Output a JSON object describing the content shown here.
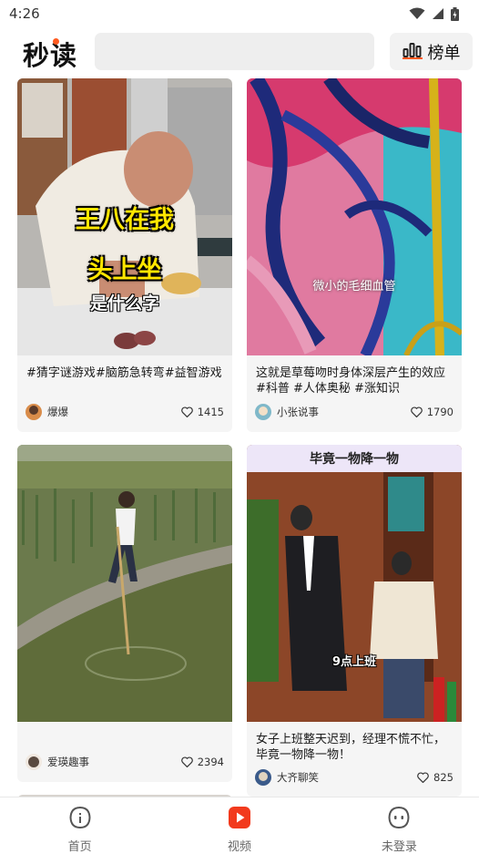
{
  "status_bar": {
    "time": "4:26"
  },
  "header": {
    "logo": "秒读",
    "rank_label": "榜单"
  },
  "feed": [
    {
      "title": "#猜字谜游戏#脑筋急转弯#益智游戏",
      "author": "爆爆",
      "likes": "1415",
      "overlay_line1": "王八在我",
      "overlay_line2": "头上坐",
      "overlay_line3": "是什么字"
    },
    {
      "title": "这就是草莓吻时身体深层产生的效应#科普 #人体奥秘 #涨知识",
      "author": "小张说事",
      "likes": "1790",
      "overlay_caption": "微小的毛细血管"
    },
    {
      "title": "",
      "author": "爱瑛趣事",
      "likes": "2394"
    },
    {
      "title": "女子上班整天迟到，经理不慌不忙，毕竟一物降一物！",
      "author": "大齐聊笑",
      "likes": "825",
      "banner": "毕竟一物降一物",
      "overlay_caption": "9点上班"
    }
  ],
  "bottom_nav": [
    {
      "label": "首页",
      "icon": "home-icon",
      "active": false
    },
    {
      "label": "视频",
      "icon": "video-play-icon",
      "active": true
    },
    {
      "label": "未登录",
      "icon": "profile-icon",
      "active": false
    }
  ],
  "colors": {
    "accent": "#ff5a1f",
    "video_red": "#f23a1d"
  }
}
